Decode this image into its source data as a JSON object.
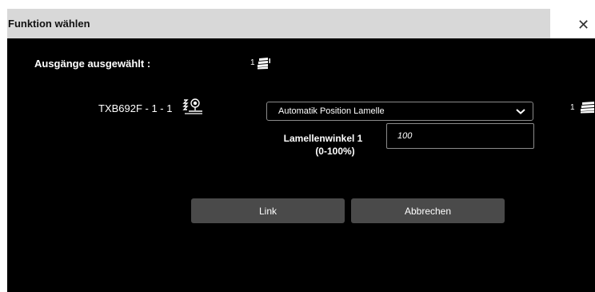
{
  "dialog": {
    "title": "Funktion wählen",
    "close_icon": "close-icon"
  },
  "outputs": {
    "label": "Ausgänge ausgewählt :",
    "count": "1",
    "icon": "shutter-stack-icon"
  },
  "device": {
    "label": "TXB692F - 1 - 1",
    "icon": "sun-sensor-icon"
  },
  "function_select": {
    "value": "Automatik Position Lamelle",
    "icon": "chevron-down-icon"
  },
  "right_count": {
    "count": "1",
    "icon": "shutter-stack-icon"
  },
  "parameter": {
    "label_line1": "Lamellenwinkel 1",
    "label_line2": "(0-100%)",
    "value": "100"
  },
  "buttons": {
    "link": "Link",
    "cancel": "Abbrechen"
  },
  "colors": {
    "background": "#000000",
    "titlebar": "#d8d8d8",
    "button": "#4a4a4a"
  }
}
